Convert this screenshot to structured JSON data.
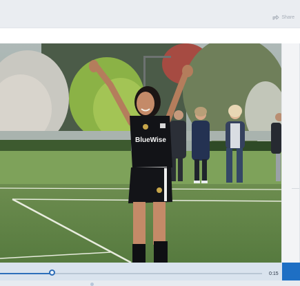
{
  "top_bar": {
    "share_label": "Share"
  },
  "video": {
    "jersey_text": "BlueWise",
    "current_time": "0:15",
    "progress_fraction": 0.17
  },
  "colors": {
    "accent": "#2c6db7",
    "play_button": "#1e6fc4",
    "player_bar": "#d9e3ee"
  },
  "icons": {
    "share": "share-icon"
  }
}
